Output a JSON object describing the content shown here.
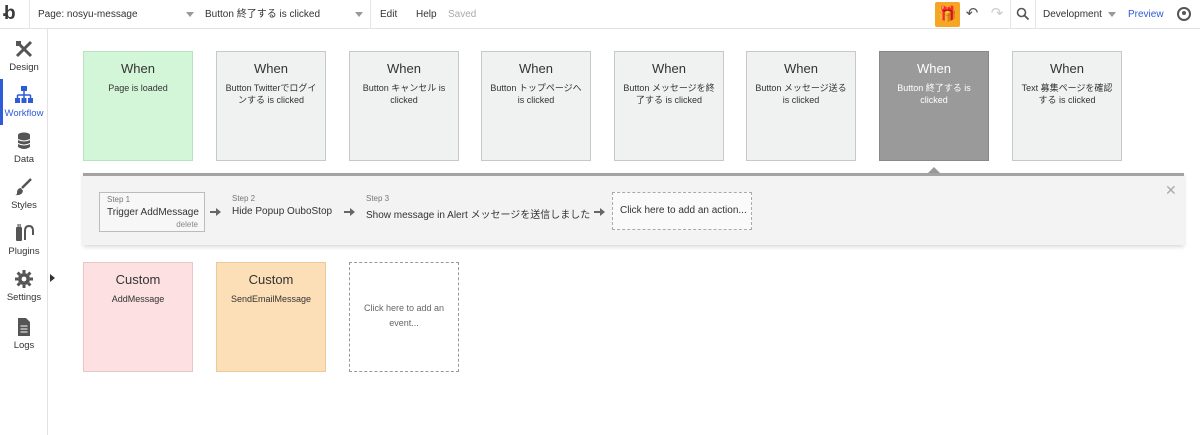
{
  "topbar": {
    "logo": "b",
    "page_select": "Page: nosyu-message",
    "event_select": "Button 終了する is clicked",
    "menu_edit": "Edit",
    "menu_help": "Help",
    "status": "Saved",
    "environment": "Development",
    "preview": "Preview",
    "accent_color": "#f5a623"
  },
  "sidebar": {
    "items": [
      {
        "label": "Design",
        "icon": "design-tools-icon"
      },
      {
        "label": "Workflow",
        "icon": "workflow-icon",
        "active": true
      },
      {
        "label": "Data",
        "icon": "database-icon"
      },
      {
        "label": "Styles",
        "icon": "brush-icon"
      },
      {
        "label": "Plugins",
        "icon": "plugin-icon"
      },
      {
        "label": "Settings",
        "icon": "gear-icon"
      },
      {
        "label": "Logs",
        "icon": "document-icon"
      }
    ],
    "active_color": "#2e5bd9"
  },
  "events": [
    {
      "title": "When",
      "sub": "Page is loaded"
    },
    {
      "title": "When",
      "sub": "Button Twitterでログインする is clicked"
    },
    {
      "title": "When",
      "sub": "Button キャンセル is clicked"
    },
    {
      "title": "When",
      "sub": "Button トップページへ is clicked"
    },
    {
      "title": "When",
      "sub": "Button メッセージを終了する is clicked"
    },
    {
      "title": "When",
      "sub": "Button メッセージ送る is clicked"
    },
    {
      "title": "When",
      "sub": "Button 終了する is clicked"
    },
    {
      "title": "When",
      "sub": "Text 募集ページを確認する is clicked"
    }
  ],
  "actions": {
    "steps": [
      {
        "num": "Step 1",
        "name": "Trigger AddMessage",
        "delete": "delete"
      },
      {
        "num": "Step 2",
        "name": "Hide Popup OuboStop"
      },
      {
        "num": "Step 3",
        "name": "Show message in Alert メッセージを送信しました"
      }
    ],
    "add_action": "Click here to add an action..."
  },
  "custom_events": [
    {
      "title": "Custom",
      "sub": "AddMessage"
    },
    {
      "title": "Custom",
      "sub": "SendEmailMessage"
    }
  ],
  "add_event": "Click here to add an event..."
}
